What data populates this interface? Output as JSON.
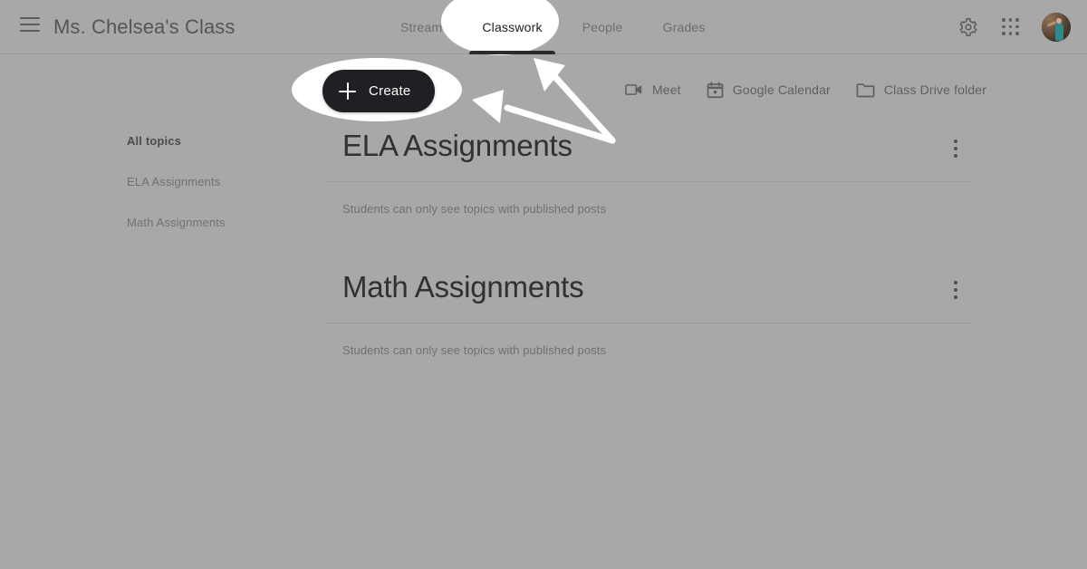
{
  "header": {
    "menu_icon": "hamburger-menu-icon",
    "class_title": "Ms. Chelsea's Class",
    "tabs": [
      {
        "label": "Stream",
        "active": false
      },
      {
        "label": "Classwork",
        "active": true
      },
      {
        "label": "People",
        "active": false
      },
      {
        "label": "Grades",
        "active": false
      }
    ],
    "settings_icon": "gear-icon",
    "apps_icon": "apps-grid-icon",
    "avatar": "user-avatar"
  },
  "toolbar": {
    "create_label": "Create",
    "create_icon": "plus-icon",
    "links": [
      {
        "label": "Meet",
        "icon": "video-camera-icon"
      },
      {
        "label": "Google Calendar",
        "icon": "calendar-icon"
      },
      {
        "label": "Class Drive folder",
        "icon": "folder-icon"
      }
    ]
  },
  "sidebar": {
    "items": [
      {
        "label": "All topics",
        "current": true
      },
      {
        "label": "ELA Assignments",
        "current": false
      },
      {
        "label": "Math Assignments",
        "current": false
      }
    ]
  },
  "main": {
    "sections": [
      {
        "title": "ELA Assignments",
        "note": "Students can only see topics with published posts",
        "menu_icon": "more-options-icon"
      },
      {
        "title": "Math Assignments",
        "note": "Students can only see topics with published posts",
        "menu_icon": "more-options-icon"
      }
    ]
  },
  "annotations": {
    "dim_overlay_color": "#a8a8a8",
    "highlight_color": "#ffffff",
    "accent_dark": "#1f2023",
    "spotlights": [
      {
        "target": "Classwork"
      },
      {
        "target": "Create"
      }
    ],
    "arrows": [
      {
        "points_to": "Classwork"
      },
      {
        "points_to": "Create"
      }
    ]
  }
}
